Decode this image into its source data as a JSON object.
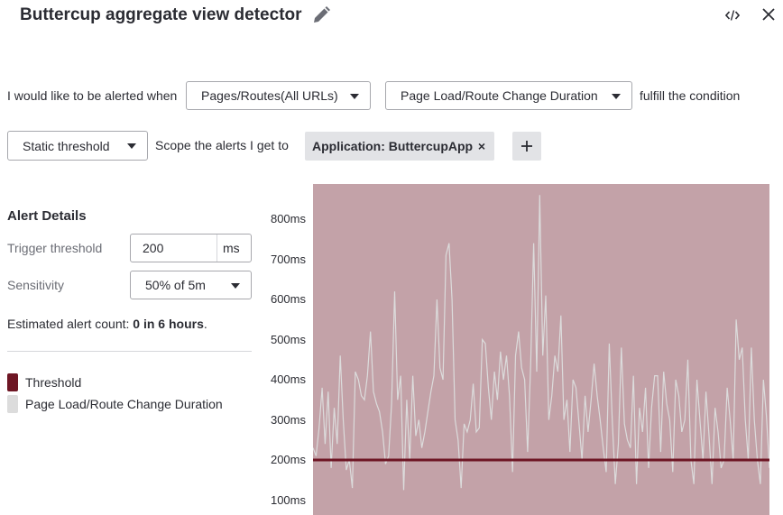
{
  "header": {
    "title": "Buttercup aggregate view detector"
  },
  "condition": {
    "prefix": "I would like to be alerted when",
    "scope_select": "Pages/Routes(All URLs)",
    "metric_select": "Page Load/Route Change Duration",
    "suffix": "fulfill the condition"
  },
  "threshold_row": {
    "type_select": "Static threshold",
    "scope_label": "Scope the alerts I get to",
    "chip_label": "Application: ButtercupApp",
    "chip_close": "×",
    "add_label": "+"
  },
  "alert_details": {
    "heading": "Alert Details",
    "trigger_label": "Trigger threshold",
    "trigger_value": "200",
    "trigger_unit": "ms",
    "sensitivity_label": "Sensitivity",
    "sensitivity_value": "50% of 5m",
    "estimate_prefix": "Estimated alert count: ",
    "estimate_value": "0 in 6 hours",
    "estimate_suffix": "."
  },
  "legend": {
    "threshold": "Threshold",
    "metric": "Page Load/Route Change Duration"
  },
  "colors": {
    "threshold": "#6e1624",
    "metric": "#dcdcdc",
    "chart_bg": "#c3a2a8"
  },
  "chart_data": {
    "type": "line",
    "y_ticks": [
      "800ms",
      "700ms",
      "600ms",
      "500ms",
      "400ms",
      "300ms",
      "200ms",
      "100ms"
    ],
    "ylim": [
      90,
      895
    ],
    "threshold": 200,
    "series": [
      {
        "name": "Page Load/Route Change Duration",
        "values": [
          230,
          210,
          280,
          380,
          240,
          370,
          180,
          330,
          240,
          460,
          300,
          175,
          200,
          130,
          420,
          400,
          360,
          350,
          410,
          520,
          370,
          340,
          320,
          270,
          190,
          210,
          340,
          620,
          350,
          410,
          125,
          350,
          200,
          410,
          260,
          300,
          230,
          270,
          320,
          370,
          410,
          600,
          430,
          400,
          710,
          740,
          600,
          300,
          250,
          130,
          290,
          270,
          300,
          390,
          270,
          280,
          500,
          490,
          380,
          300,
          420,
          350,
          470,
          400,
          460,
          360,
          170,
          460,
          520,
          430,
          400,
          220,
          440,
          740,
          420,
          860,
          460,
          610,
          300,
          360,
          460,
          420,
          560,
          300,
          350,
          220,
          400,
          380,
          290,
          200,
          360,
          270,
          350,
          440,
          360,
          300,
          230,
          170,
          490,
          300,
          140,
          240,
          480,
          290,
          250,
          230,
          410,
          140,
          330,
          270,
          380,
          180,
          330,
          410,
          410,
          220,
          420,
          340,
          300,
          170,
          400,
          360,
          270,
          300,
          450,
          200,
          140,
          400,
          300,
          200,
          370,
          260,
          140,
          330,
          270,
          180,
          200,
          380,
          300,
          200,
          550,
          450,
          480,
          300,
          200,
          480,
          300,
          200,
          140,
          400,
          310,
          180
        ]
      }
    ]
  }
}
